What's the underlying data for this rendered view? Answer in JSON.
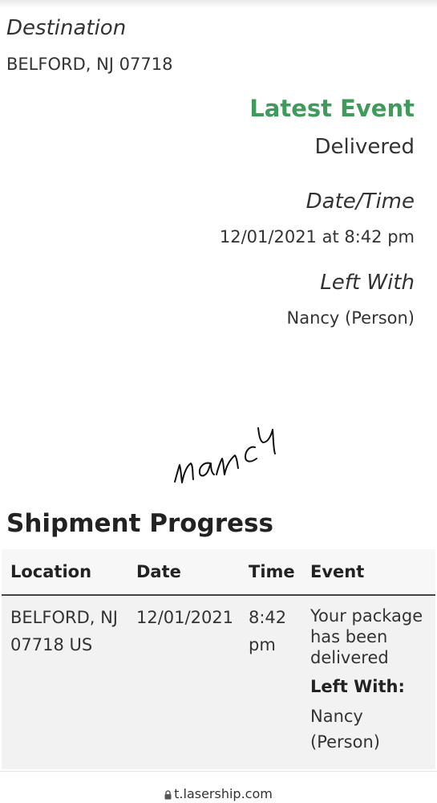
{
  "destination": {
    "label": "Destination",
    "value": "BELFORD, NJ 07718"
  },
  "latest_event": {
    "title": "Latest Event",
    "value": "Delivered",
    "datetime_label": "Date/Time",
    "datetime_value": "12/01/2021 at 8:42 pm",
    "left_with_label": "Left With",
    "left_with_value": "Nancy (Person)",
    "signature": "nancy"
  },
  "shipment_progress": {
    "title": "Shipment Progress",
    "columns": [
      "Location",
      "Date",
      "Time",
      "Event"
    ],
    "rows": [
      {
        "location_line1": "BELFORD, NJ",
        "location_line2": "07718 US",
        "date": "12/01/2021",
        "time_line1": "8:42",
        "time_line2": "pm",
        "event_line1": "Your package",
        "event_line2": "has been",
        "event_line3": "delivered",
        "left_with_label": "Left With:",
        "left_with_line1": "Nancy",
        "left_with_line2": "(Person)"
      }
    ]
  },
  "browser": {
    "url": "t.lasership.com",
    "lock_icon": "lock-icon"
  }
}
